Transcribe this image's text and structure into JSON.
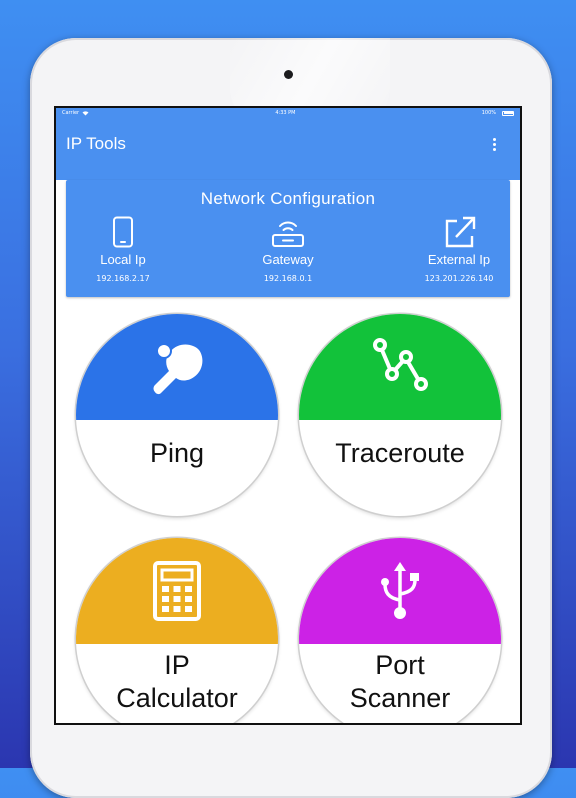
{
  "status_bar": {
    "carrier": "Carrier",
    "time": "4:33 PM",
    "battery": "100%"
  },
  "app_bar": {
    "title": "IP Tools",
    "menu_icon": "more-vert-icon"
  },
  "network_config": {
    "heading": "Network Configuration",
    "local": {
      "label": "Local Ip",
      "value": "192.168.2.17",
      "icon": "phone-icon"
    },
    "gateway": {
      "label": "Gateway",
      "value": "192.168.0.1",
      "icon": "router-icon"
    },
    "external": {
      "label": "External Ip",
      "value": "123.201.226.140",
      "icon": "external-link-icon"
    }
  },
  "tools": [
    {
      "label": "Ping",
      "color": "#2b73e8",
      "icon": "ping-pong-icon"
    },
    {
      "label": "Traceroute",
      "color": "#12c23a",
      "icon": "route-icon"
    },
    {
      "label_line1": "IP",
      "label_line2": "Calculator",
      "color": "#ecae20",
      "icon": "calculator-icon"
    },
    {
      "label_line1": "Port",
      "label_line2": "Scanner",
      "color": "#cc22e6",
      "icon": "usb-icon"
    }
  ],
  "colors": {
    "primary": "#4a90f0",
    "background_top": "#3f8ff2",
    "background_bottom": "#2b36b0"
  }
}
